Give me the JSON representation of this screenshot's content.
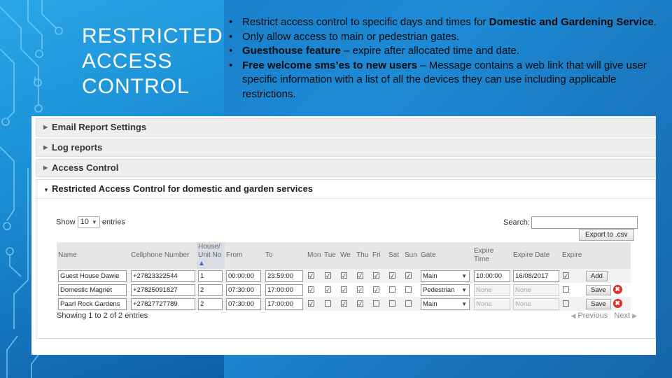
{
  "slide": {
    "title_lines": [
      "RESTRICTED",
      "ACCESS",
      "CONTROL"
    ],
    "bullets": [
      {
        "pre": "Restrict access control to specific days and times for ",
        "bold": "Domestic and Gardening Service",
        "post": "."
      },
      {
        "pre": "Only allow access to main or pedestrian gates.",
        "bold": "",
        "post": ""
      },
      {
        "pre": "",
        "bold": "Guesthouse feature",
        "post": " – expire after allocated time and date."
      },
      {
        "pre": "",
        "bold": "Free welcome sms’es to new users",
        "post": " – Message contains a web link that will give user specific information with a list of all the devices they can use including applicable restrictions."
      }
    ]
  },
  "app": {
    "accordion": [
      "Email Report Settings",
      "Log reports",
      "Access Control"
    ],
    "open_section": "Restricted Access Control for domestic and garden services",
    "show_label": "Show",
    "show_value": "10",
    "entries_label": "entries",
    "search_label": "Search:",
    "export_label": "Export to .csv",
    "columns": [
      "Name",
      "Cellphone Number",
      "House/ Unit No",
      "From",
      "To",
      "Mon",
      "Tue",
      "We",
      "Thu",
      "Fri",
      "Sat",
      "Sun",
      "Gate",
      "Expire Time",
      "Expire Date",
      "Expire"
    ],
    "rows": [
      {
        "name": "Guest House Dawie",
        "cell": "+27823322544",
        "unit": "1",
        "from": "00:00:00",
        "to": "23:59:00",
        "days": [
          true,
          true,
          true,
          true,
          true,
          true,
          true
        ],
        "gate": "Main",
        "expire_time": "10:00:00",
        "expire_date": "16/08/2017",
        "expire": true,
        "action": "Add",
        "delete": false
      },
      {
        "name": "Domestic Magriet",
        "cell": "+27825091827",
        "unit": "2",
        "from": "07:30:00",
        "to": "17:00:00",
        "days": [
          true,
          true,
          true,
          true,
          true,
          false,
          false
        ],
        "gate": "Pedestrian",
        "expire_time": "None",
        "expire_date": "None",
        "expire": false,
        "action": "Save",
        "delete": true
      },
      {
        "name": "Paarl Rock Gardens",
        "cell": "+27827727789",
        "unit": "2",
        "from": "07:30:00",
        "to": "17:00:00",
        "days": [
          true,
          false,
          true,
          true,
          false,
          false,
          false
        ],
        "gate": "Main",
        "expire_time": "None",
        "expire_date": "None",
        "expire": false,
        "action": "Save",
        "delete": true
      }
    ],
    "info": "Showing 1 to 2 of 2 entries",
    "prev": "Previous",
    "next": "Next"
  },
  "colors": {
    "accent": "#1b8fd6",
    "delete": "#d9342a"
  }
}
